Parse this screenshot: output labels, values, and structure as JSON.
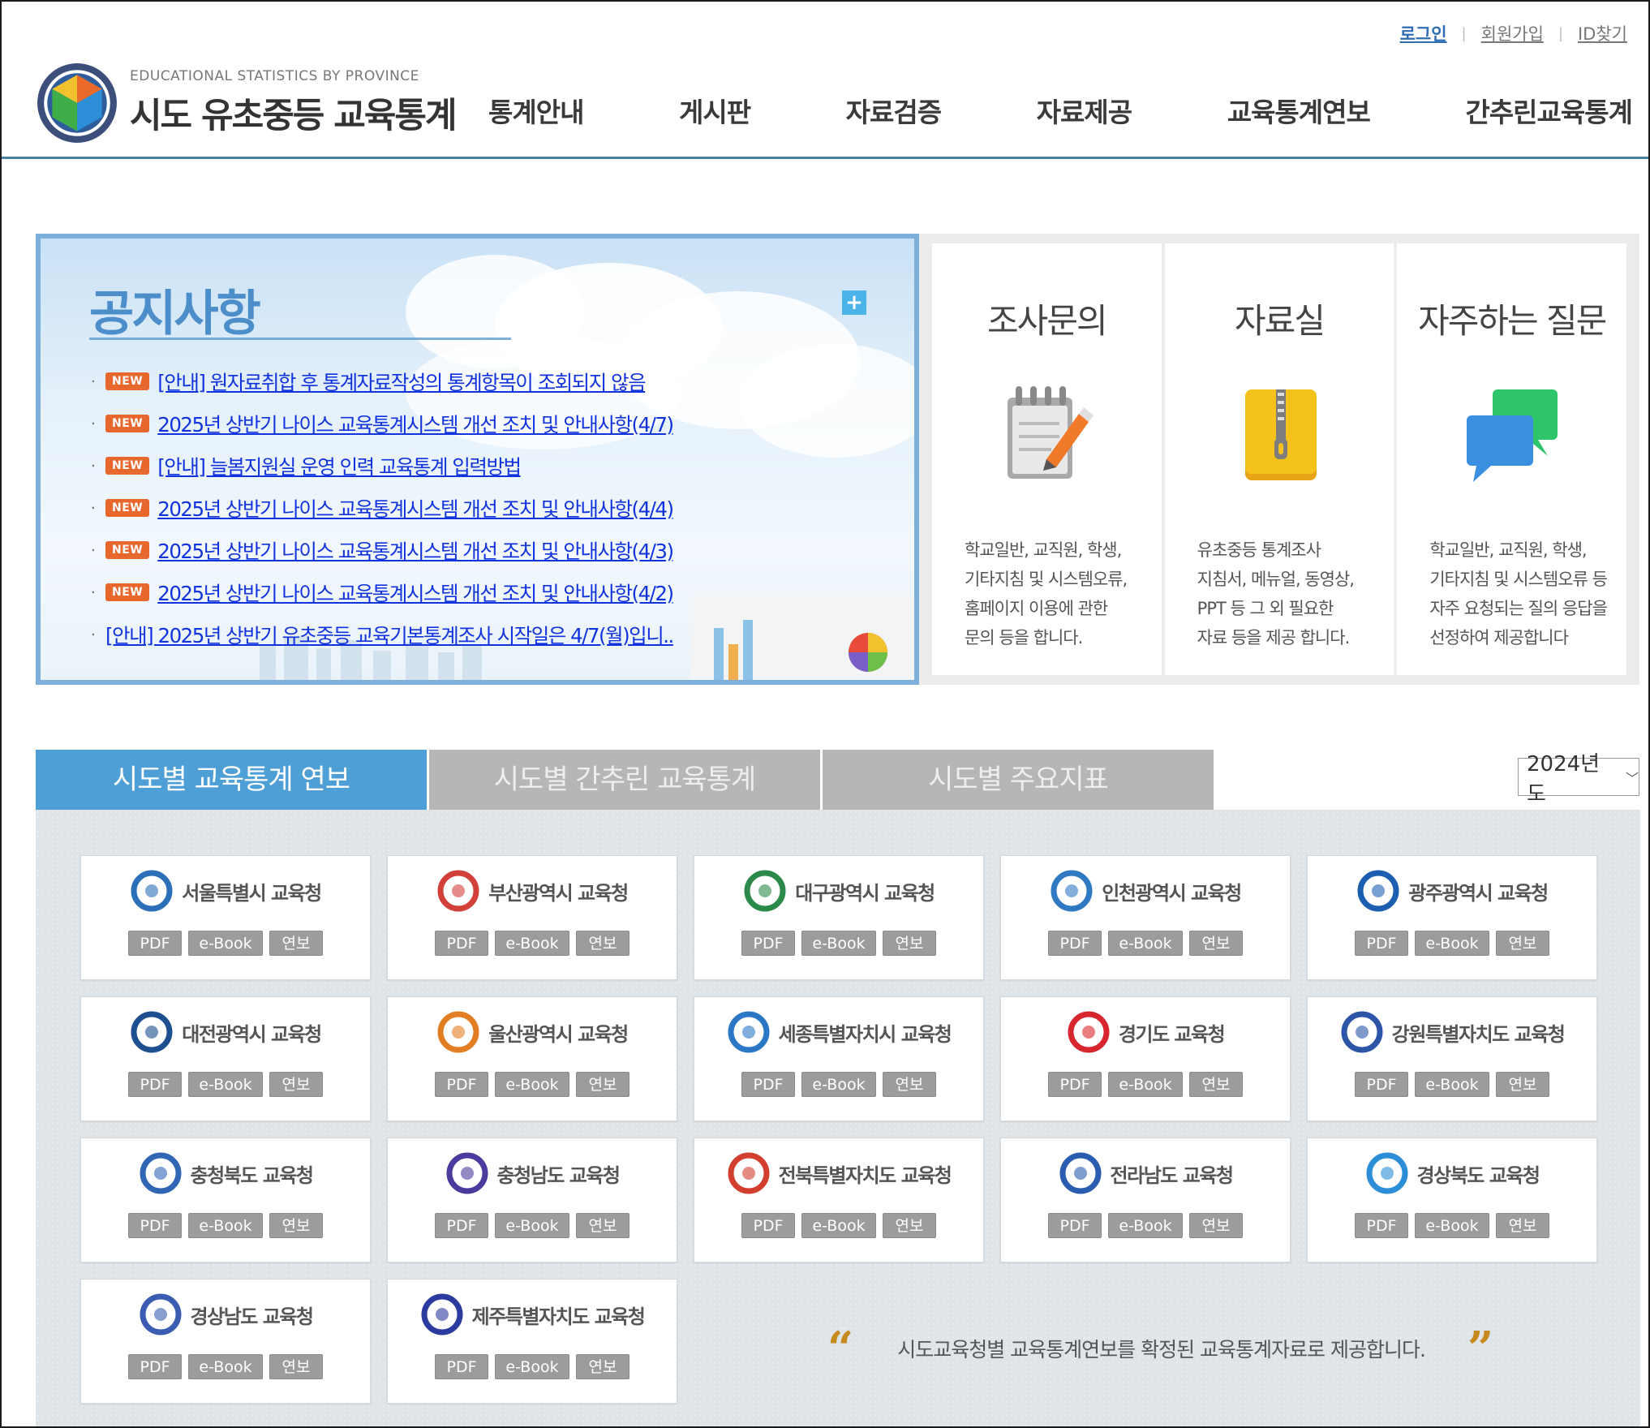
{
  "header": {
    "util_links": [
      "로그인",
      "회원가입",
      "ID찾기"
    ],
    "logo_en": "EDUCATIONAL STATISTICS BY PROVINCE",
    "logo_ko": "시도 유초중등 교육통계",
    "nav": [
      "통계안내",
      "게시판",
      "자료검증",
      "자료제공",
      "교육통계연보",
      "간추린교육통계"
    ]
  },
  "notice": {
    "title": "공지사항",
    "more": "+",
    "badge": "NEW",
    "items": [
      {
        "text": "[안내] 원자료취합 후 통계자료작성의 통계항목이 조회되지 않음",
        "new": true
      },
      {
        "text": "2025년 상반기 나이스 교육통계시스템 개선 조치 및 안내사항(4/7)",
        "new": true
      },
      {
        "text": "[안내] 늘봄지원실 운영 인력 교육통계 입력방법",
        "new": true
      },
      {
        "text": "2025년 상반기 나이스 교육통계시스템 개선 조치 및 안내사항(4/4)",
        "new": true
      },
      {
        "text": "2025년 상반기 나이스 교육통계시스템 개선 조치 및 안내사항(4/3)",
        "new": true
      },
      {
        "text": "2025년 상반기 나이스 교육통계시스템 개선 조치 및 안내사항(4/2)",
        "new": true
      },
      {
        "text": "[안내] 2025년 상반기 유초중등 교육기본통계조사 시작일은 4/7(월)입니..",
        "new": false
      }
    ]
  },
  "quick": [
    {
      "title": "조사문의",
      "icon": "notepad-pencil-icon",
      "desc": "학교일반, 교직원, 학생,\n기타지침 및 시스템오류,\n홈페이지 이용에 관한\n문의 등을 합니다."
    },
    {
      "title": "자료실",
      "icon": "zip-archive-icon",
      "desc": "유초중등 통계조사\n지침서, 메뉴얼, 동영상,\nPPT 등 그 외 필요한\n자료 등을 제공 합니다."
    },
    {
      "title": "자주하는 질문",
      "icon": "chat-bubbles-icon",
      "desc": "학교일반, 교직원, 학생,\n기타지침 및 시스템오류 등\n자주 요청되는 질의 응답을\n선정하여 제공합니다"
    }
  ],
  "tabs": [
    "시도별 교육통계 연보",
    "시도별 간추린 교육통계",
    "시도별 주요지표"
  ],
  "year_select": {
    "value": "2024년도"
  },
  "buttons": {
    "pdf": "PDF",
    "ebook": "e-Book",
    "yearbook": "연보"
  },
  "offices": [
    {
      "name": "서울특별시 교육청",
      "color": "#2a6fb8"
    },
    {
      "name": "부산광역시 교육청",
      "color": "#d2403a"
    },
    {
      "name": "대구광역시 교육청",
      "color": "#2b8a4a"
    },
    {
      "name": "인천광역시 교육청",
      "color": "#2f79c3"
    },
    {
      "name": "광주광역시 교육청",
      "color": "#1c5fb0"
    },
    {
      "name": "대전광역시 교육청",
      "color": "#1d4f8f"
    },
    {
      "name": "울산광역시 교육청",
      "color": "#e27d24"
    },
    {
      "name": "세종특별자치시 교육청",
      "color": "#2a77c6"
    },
    {
      "name": "경기도 교육청",
      "color": "#d8262e"
    },
    {
      "name": "강원특별자치도 교육청",
      "color": "#2c55a8"
    },
    {
      "name": "충청북도 교육청",
      "color": "#3166b4"
    },
    {
      "name": "충청남도 교육청",
      "color": "#4b3b9c"
    },
    {
      "name": "전북특별자치도 교육청",
      "color": "#d33f2f"
    },
    {
      "name": "전라남도 교육청",
      "color": "#2a5db0"
    },
    {
      "name": "경상북도 교육청",
      "color": "#2b8ed6"
    },
    {
      "name": "경상남도 교육청",
      "color": "#3b5db1"
    },
    {
      "name": "제주특별자치도 교육청",
      "color": "#2c3b9e"
    }
  ],
  "quote": {
    "open": "“",
    "text": "시도교육청별 교육통계연보를 확정된 교육통계자료로 제공합니다.",
    "close": "”"
  }
}
